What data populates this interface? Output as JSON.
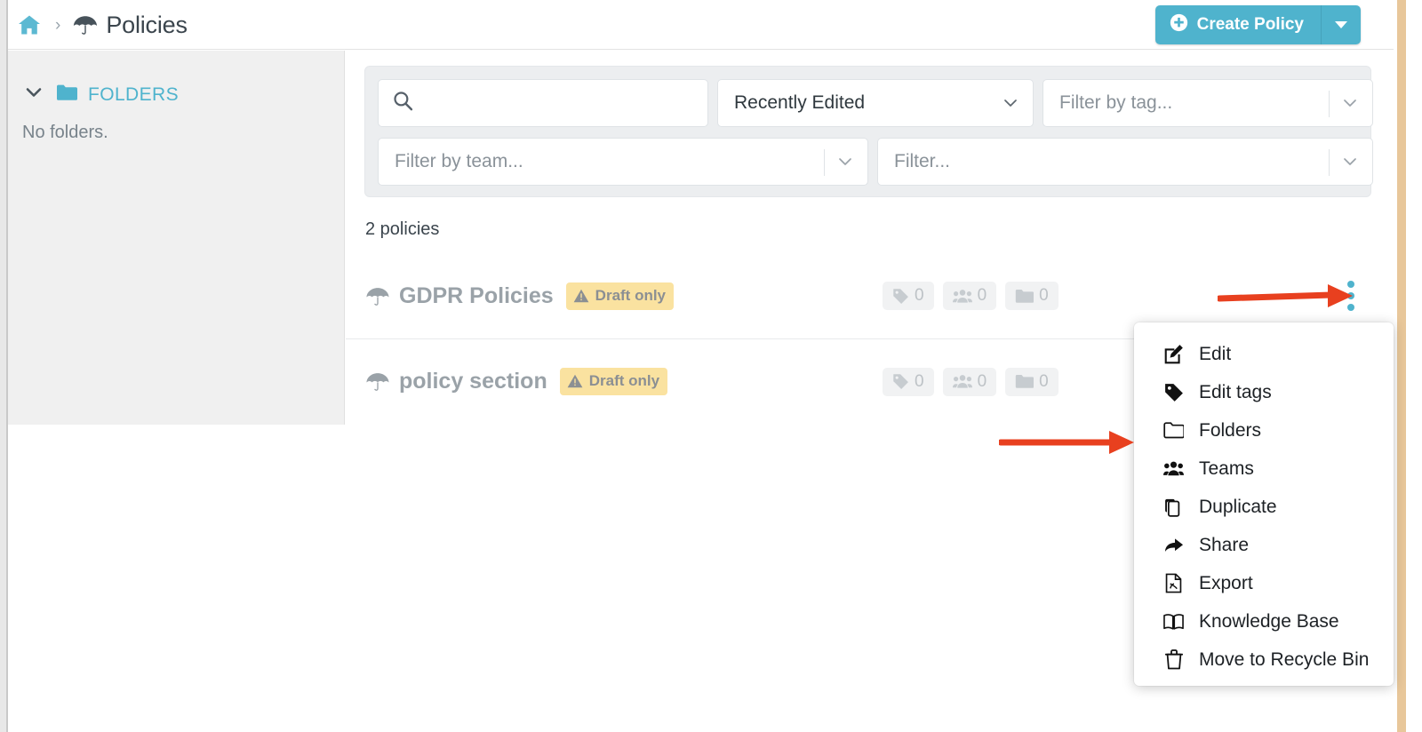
{
  "header": {
    "home_icon": "home-icon",
    "separator": "›",
    "policy_icon": "umbrella-icon",
    "title": "Policies",
    "create_button_label": "Create Policy",
    "create_button_icon": "plus-circle-icon",
    "create_dropdown_icon": "caret-down-icon",
    "accent_color": "#4fb3cd"
  },
  "sidebar": {
    "collapse_icon": "chevron-down-icon",
    "folder_icon": "folder-icon",
    "section_label": "FOLDERS",
    "empty_text": "No folders."
  },
  "filters": {
    "search": {
      "value": "",
      "placeholder": "",
      "icon": "search-icon"
    },
    "sort": {
      "value": "Recently Edited",
      "icon": "chevron-down-icon"
    },
    "tag": {
      "value": "",
      "placeholder": "Filter by tag...",
      "icon": "chevron-down-icon"
    },
    "team": {
      "value": "",
      "placeholder": "Filter by team...",
      "icon": "chevron-down-icon"
    },
    "generic": {
      "value": "",
      "placeholder": "Filter...",
      "icon": "chevron-down-icon"
    }
  },
  "list": {
    "count_text": "2 policies",
    "rows": [
      {
        "icon": "umbrella-icon",
        "title": "GDPR Policies",
        "badge": {
          "label": "Draft only",
          "icon": "warning-triangle-icon",
          "color": "#fae2a0"
        },
        "chips": [
          {
            "icon": "tag-icon",
            "value": "0"
          },
          {
            "icon": "users-icon",
            "value": "0"
          },
          {
            "icon": "folder-icon",
            "value": "0"
          }
        ],
        "menu_icon": "kebab-menu-icon"
      },
      {
        "icon": "umbrella-icon",
        "title": "policy section",
        "badge": {
          "label": "Draft only",
          "icon": "warning-triangle-icon",
          "color": "#fae2a0"
        },
        "chips": [
          {
            "icon": "tag-icon",
            "value": "0"
          },
          {
            "icon": "users-icon",
            "value": "0"
          },
          {
            "icon": "folder-icon",
            "value": "0"
          }
        ],
        "menu_icon": "kebab-menu-icon"
      }
    ]
  },
  "context_menu": {
    "items": [
      {
        "label": "Edit",
        "icon": "pencil-square-icon"
      },
      {
        "label": "Edit tags",
        "icon": "tag-icon"
      },
      {
        "label": "Folders",
        "icon": "folder-outline-icon"
      },
      {
        "label": "Teams",
        "icon": "users-icon"
      },
      {
        "label": "Duplicate",
        "icon": "copy-icon"
      },
      {
        "label": "Share",
        "icon": "share-arrow-icon"
      },
      {
        "label": "Export",
        "icon": "file-pdf-icon"
      },
      {
        "label": "Knowledge Base",
        "icon": "open-book-icon"
      },
      {
        "label": "Move to Recycle Bin",
        "icon": "trash-icon"
      }
    ]
  },
  "annotations": {
    "color": "#e8401f",
    "arrows": [
      {
        "name": "arrow-to-kebab-menu",
        "target": "kebab-menu-icon"
      },
      {
        "name": "arrow-to-teams-item",
        "target": "Teams"
      }
    ]
  }
}
